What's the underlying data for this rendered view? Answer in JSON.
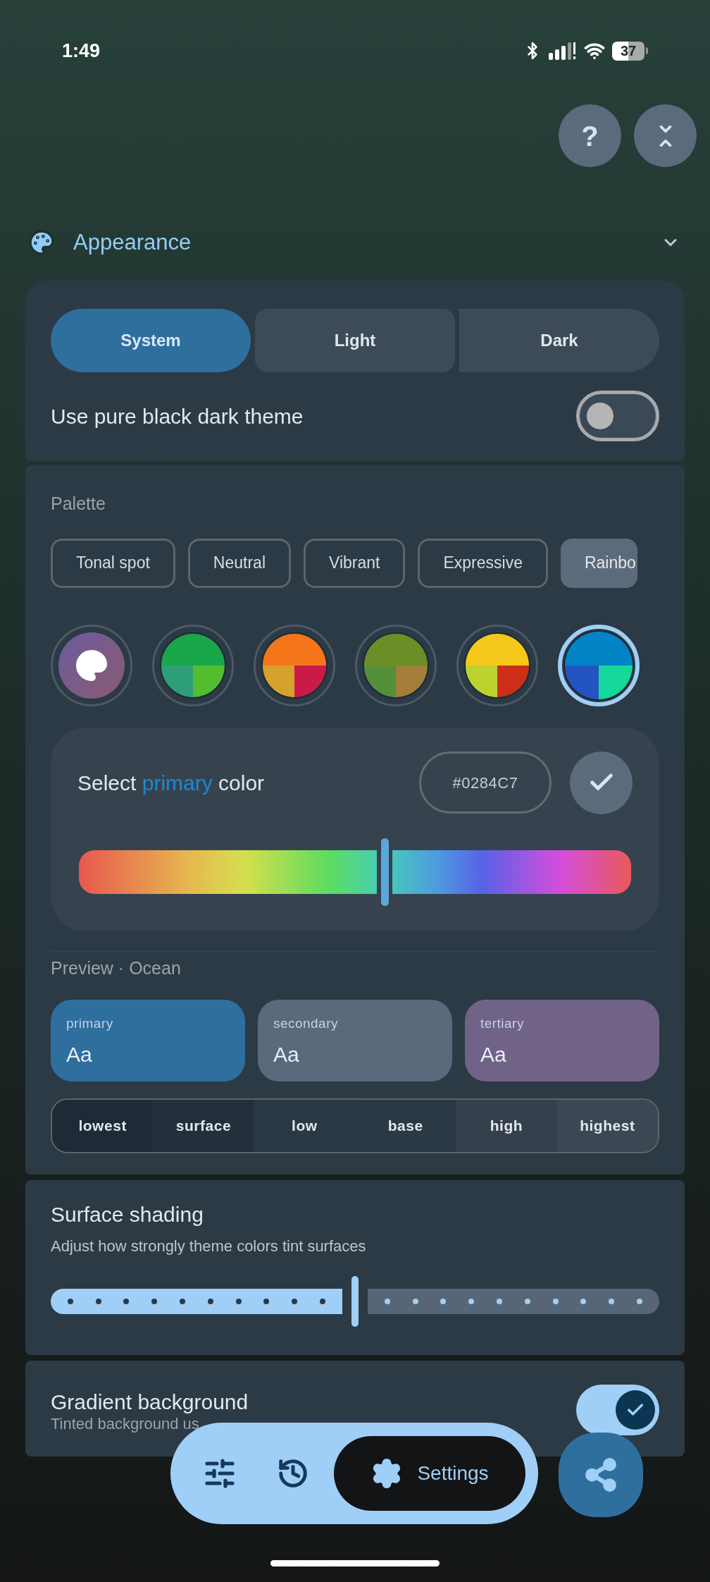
{
  "status_bar": {
    "time": "1:49",
    "battery": "37"
  },
  "help_button": {
    "label": "?"
  },
  "section": {
    "title": "Appearance",
    "expanded": true
  },
  "theme_modes": [
    {
      "label": "System",
      "selected": true
    },
    {
      "label": "Light",
      "selected": false
    },
    {
      "label": "Dark",
      "selected": false
    }
  ],
  "pure_black": {
    "label": "Use pure black dark theme",
    "on": false
  },
  "palette": {
    "label": "Palette",
    "styles": [
      {
        "label": "Tonal spot",
        "selected": false
      },
      {
        "label": "Neutral",
        "selected": false
      },
      {
        "label": "Vibrant",
        "selected": false
      },
      {
        "label": "Expressive",
        "selected": false
      },
      {
        "label": "Rainbo",
        "selected": true
      }
    ],
    "swatches": [
      {
        "kind": "custom",
        "selected": false
      },
      {
        "kind": "preset",
        "selected": false,
        "segments": [
          {
            "color": "#1aa64a"
          },
          {
            "color": "#2e9e7a"
          },
          {
            "color": "#52bd2e"
          }
        ]
      },
      {
        "kind": "preset",
        "selected": false,
        "segments": [
          {
            "color": "#f5761a"
          },
          {
            "color": "#d6a22e"
          },
          {
            "color": "#cc1a48"
          }
        ]
      },
      {
        "kind": "preset",
        "selected": false,
        "segments": [
          {
            "color": "#6b8f26"
          },
          {
            "color": "#548f3a"
          },
          {
            "color": "#a37f3a"
          }
        ]
      },
      {
        "kind": "preset",
        "selected": false,
        "segments": [
          {
            "color": "#f5c81a"
          },
          {
            "color": "#bcd22e"
          },
          {
            "color": "#cc2e1a"
          }
        ]
      },
      {
        "kind": "preset",
        "selected": true,
        "segments": [
          {
            "color": "#0284c7"
          },
          {
            "color": "#2454c2"
          },
          {
            "color": "#14d99a"
          }
        ]
      }
    ]
  },
  "color_picker": {
    "title": "Select **primary** color",
    "hex": "#0284C7",
    "hue": {
      "level": 0.553
    }
  },
  "preview": {
    "label": "Preview · Ocean",
    "cards": [
      {
        "label": "primary",
        "sample": "Aa",
        "color": "#2e6f9e"
      },
      {
        "label": "secondary",
        "sample": "Aa",
        "color": "#5a6a7c"
      },
      {
        "label": "tertiary",
        "sample": "Aa",
        "color": "#716387"
      }
    ],
    "surfaces": [
      {
        "label": "lowest",
        "color": "#1e2a35"
      },
      {
        "label": "surface",
        "color": "#232f3b"
      },
      {
        "label": "low",
        "color": "#2a3843"
      },
      {
        "label": "base",
        "color": "#2b3945"
      },
      {
        "label": "high",
        "color": "#34414d"
      },
      {
        "label": "highest",
        "color": "#3b4854"
      }
    ]
  },
  "surface_shading": {
    "title": "Surface shading",
    "description": "Adjust how strongly theme colors tint surfaces",
    "level": 0.5
  },
  "gradient_background": {
    "title": "Gradient background",
    "description": "Tinted background us",
    "on": true
  },
  "nav": {
    "items": [
      {
        "kind": "tune",
        "selected": false
      },
      {
        "kind": "history",
        "selected": false
      },
      {
        "kind": "settings",
        "label": "Settings",
        "selected": true
      }
    ]
  }
}
